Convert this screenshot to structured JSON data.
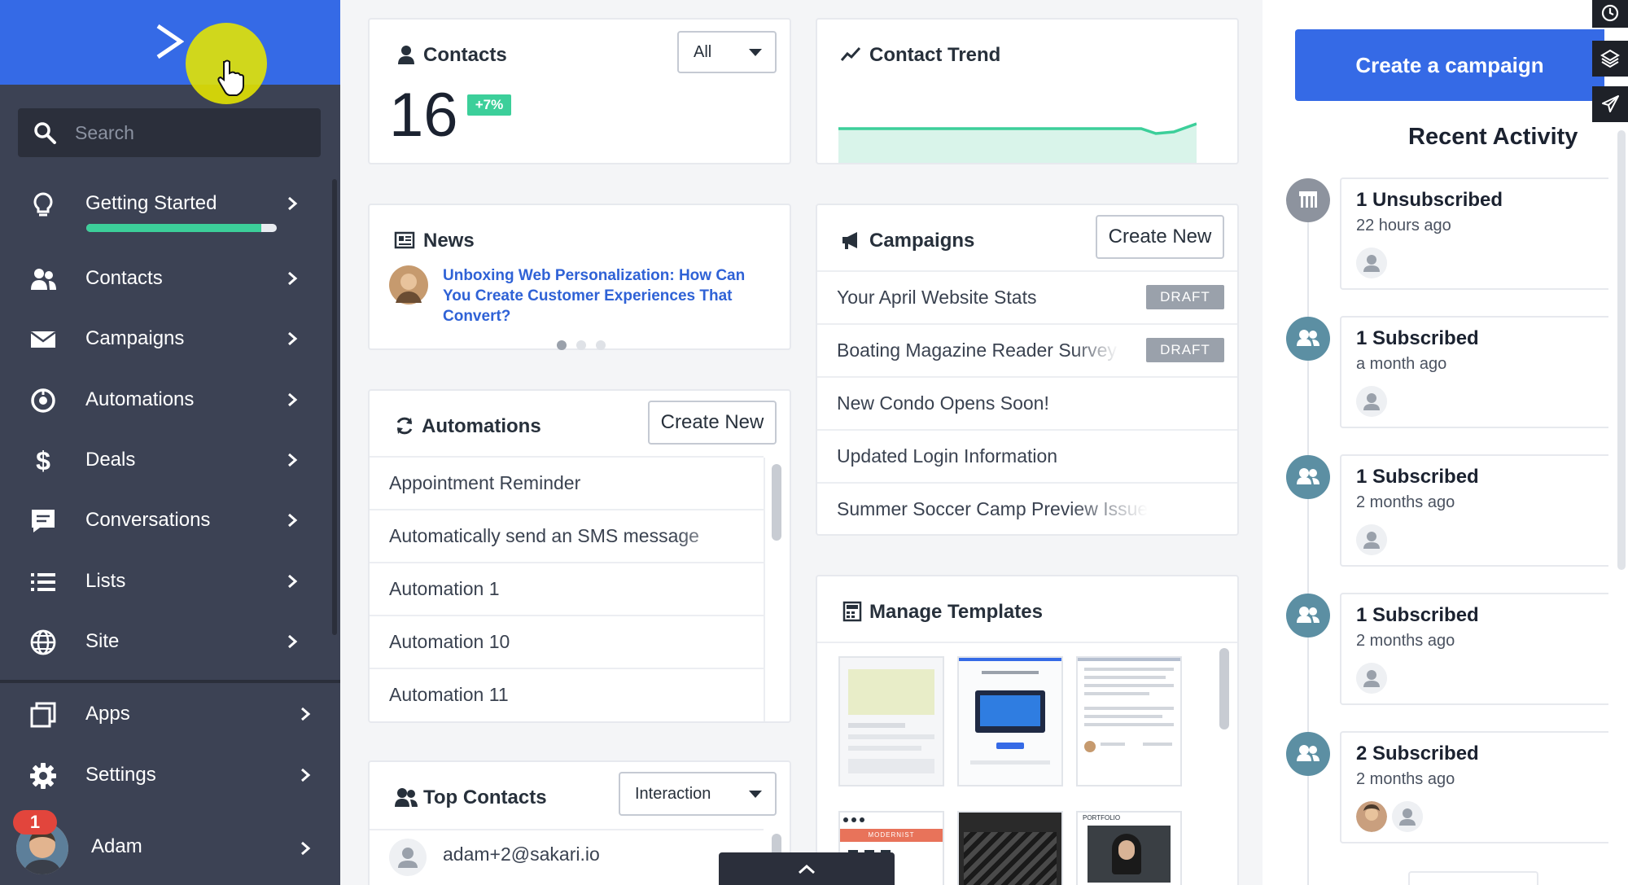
{
  "sidebar": {
    "search_placeholder": "Search",
    "getting_started": {
      "label": "Getting Started",
      "progress": 0.92
    },
    "items": [
      {
        "label": "Contacts",
        "icon": "contacts-icon"
      },
      {
        "label": "Campaigns",
        "icon": "envelope-icon"
      },
      {
        "label": "Automations",
        "icon": "automations-icon"
      },
      {
        "label": "Deals",
        "icon": "dollar-icon"
      },
      {
        "label": "Conversations",
        "icon": "chat-icon"
      },
      {
        "label": "Lists",
        "icon": "list-icon"
      },
      {
        "label": "Site",
        "icon": "globe-icon"
      }
    ],
    "bottom_items": [
      {
        "label": "Apps",
        "icon": "apps-icon"
      },
      {
        "label": "Settings",
        "icon": "gear-icon"
      }
    ],
    "user": {
      "name": "Adam",
      "notification_count": "1"
    }
  },
  "contacts_card": {
    "title": "Contacts",
    "count": "16",
    "change": "+7%",
    "filter": "All"
  },
  "trend_card": {
    "title": "Contact Trend"
  },
  "news_card": {
    "title": "News",
    "headline_line1": "Unboxing Web Personalization: How Can",
    "headline_line2": "You Create Customer Experiences That",
    "headline_line3": "Convert?"
  },
  "campaigns_card": {
    "title": "Campaigns",
    "create_label": "Create New",
    "rows": [
      {
        "name": "Your April Website Stats",
        "status": "DRAFT"
      },
      {
        "name": "Boating Magazine Reader Survey",
        "status": "DRAFT"
      },
      {
        "name": "New Condo Opens Soon!",
        "status": ""
      },
      {
        "name": "Updated Login Information",
        "status": ""
      },
      {
        "name": "Summer Soccer Camp Preview Issue",
        "status": ""
      }
    ]
  },
  "automations_card": {
    "title": "Automations",
    "create_label": "Create New",
    "rows": [
      "Appointment Reminder",
      "Automatically send an SMS message",
      "Automation 1",
      "Automation 10",
      "Automation 11"
    ]
  },
  "templates_card": {
    "title": "Manage Templates",
    "thumb_labels": [
      "MODERNIST",
      "PORTFOLIO"
    ]
  },
  "top_contacts_card": {
    "title": "Top Contacts",
    "filter": "Interaction",
    "rows": [
      "adam+2@sakari.io"
    ]
  },
  "right": {
    "create_campaign": "Create a campaign",
    "recent_activity_title": "Recent Activity",
    "activities": [
      {
        "title": "1 Unsubscribed",
        "time": "22 hours ago",
        "icon": "unsubscribe-icon"
      },
      {
        "title": "1 Subscribed",
        "time": "a month ago",
        "icon": "users-icon"
      },
      {
        "title": "1 Subscribed",
        "time": "2 months ago",
        "icon": "users-icon"
      },
      {
        "title": "1 Subscribed",
        "time": "2 months ago",
        "icon": "users-icon"
      },
      {
        "title": "2 Subscribed",
        "time": "2 months ago",
        "icon": "users-icon"
      }
    ]
  },
  "colors": {
    "brand_blue": "#356ae6",
    "sidebar": "#3c4254",
    "accent_green": "#3ccf9a",
    "draft_gray": "#9aa1ab",
    "link_blue": "#2f62d6",
    "activity_teal": "#5c8fa3"
  }
}
